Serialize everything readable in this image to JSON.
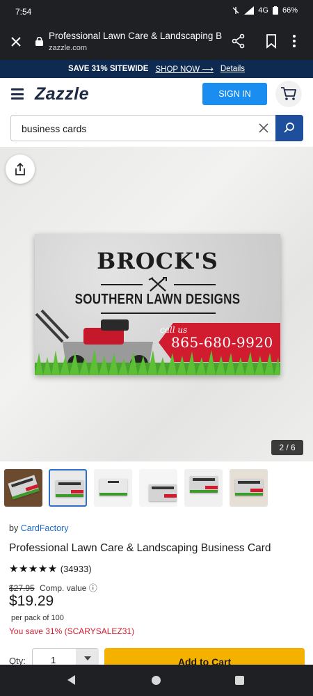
{
  "status_bar": {
    "time": "7:54",
    "network": "4G",
    "battery": "66%"
  },
  "browser": {
    "title": "Professional Lawn Care & Landscaping Bu...",
    "url": "zazzle.com"
  },
  "promo": {
    "text": "SAVE 31% SITEWIDE",
    "shop_link": "SHOP NOW ⟶",
    "details_link": "Details"
  },
  "header": {
    "logo": "Zazzle",
    "signin_label": "SIGN IN"
  },
  "search": {
    "value": "business cards"
  },
  "hero": {
    "image_counter": "2 / 6",
    "card": {
      "brand": "BROCK'S",
      "subtitle": "SOUTHERN LAWN DESIGNS",
      "call_us": "call us",
      "phone": "865-680-9920"
    }
  },
  "product": {
    "by_prefix": "by",
    "designer": "CardFactory",
    "title": "Professional Lawn Care & Landscaping Business Card",
    "stars": "★★★★★",
    "rating_value": 5,
    "review_count": "(34933)",
    "original_price": "$27.95",
    "comp_value_label": "Comp. value ⓘ",
    "price": "$19.29",
    "per_pack": "per pack of 100",
    "savings": "You save 31% (SCARYSALEZ31)",
    "qty_label": "Qty:",
    "qty_value": "1",
    "add_to_cart": "Add to Cart"
  },
  "colors": {
    "brand_navy": "#0e2a50",
    "signin_blue": "#1a8ef0",
    "sale_red": "#d11c30",
    "cta_yellow": "#f4b100"
  }
}
